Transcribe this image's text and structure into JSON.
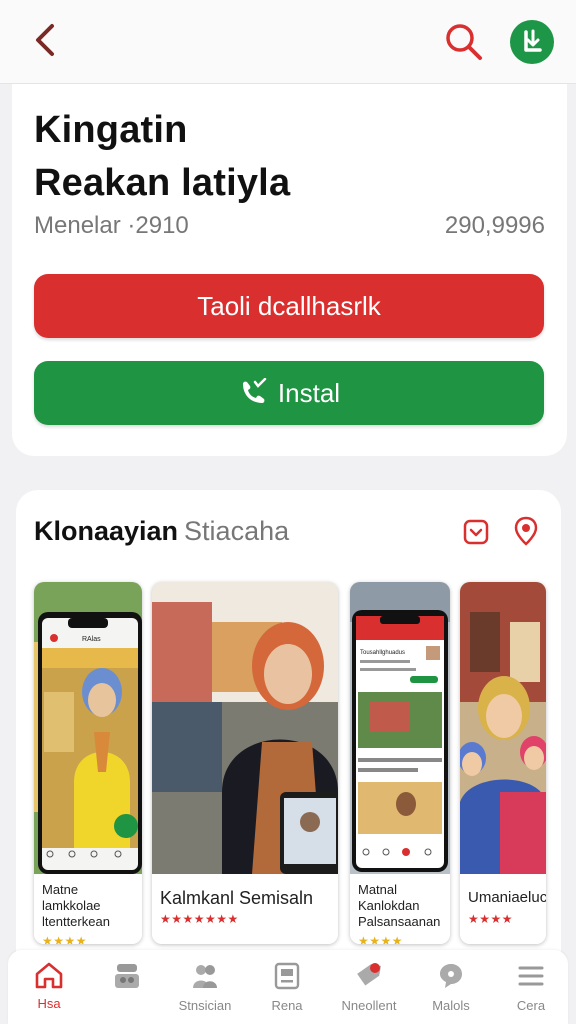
{
  "header": {
    "back_icon": "chevron-left-icon",
    "search_icon": "search-icon",
    "account_icon": "download-badge-icon"
  },
  "app": {
    "title_line1": "Kingatin",
    "title_line2": "Reakan latiyla",
    "meta_left": "Menelar ·2910",
    "meta_right": "290,9996",
    "primary_button": "Taoli  dcallhasrlk",
    "install_button": "Instal"
  },
  "screenshots": {
    "title": "Klonaayian",
    "subtitle": "Stiacaha",
    "items": [
      {
        "caption": "Matne lamkkolae ltentterkean",
        "stars": "★★★★"
      },
      {
        "caption": "Kalmkanl Semisaln",
        "stars": "★★★★★★★"
      },
      {
        "caption": "Matnal Kanlokdan Palsansaanan",
        "stars": "★★★★"
      },
      {
        "caption": "Umaniaeluc",
        "stars": "★★★★"
      }
    ],
    "phone1_header": "RAlas",
    "phone3_header": "Tousahllghuadus"
  },
  "nav": {
    "items": [
      {
        "label": "Hsa",
        "icon": "home-icon"
      },
      {
        "label": "",
        "icon": "store-icon"
      },
      {
        "label": "Stnsician",
        "icon": "people-icon"
      },
      {
        "label": "Rena",
        "icon": "news-icon"
      },
      {
        "label": "Nneollent",
        "icon": "tag-icon"
      },
      {
        "label": "Malols",
        "icon": "chat-icon"
      },
      {
        "label": "Cera",
        "icon": "menu-icon"
      }
    ]
  },
  "colors": {
    "accent_red": "#d9302f",
    "accent_green": "#1f9442",
    "star_yellow": "#e7b21b"
  }
}
